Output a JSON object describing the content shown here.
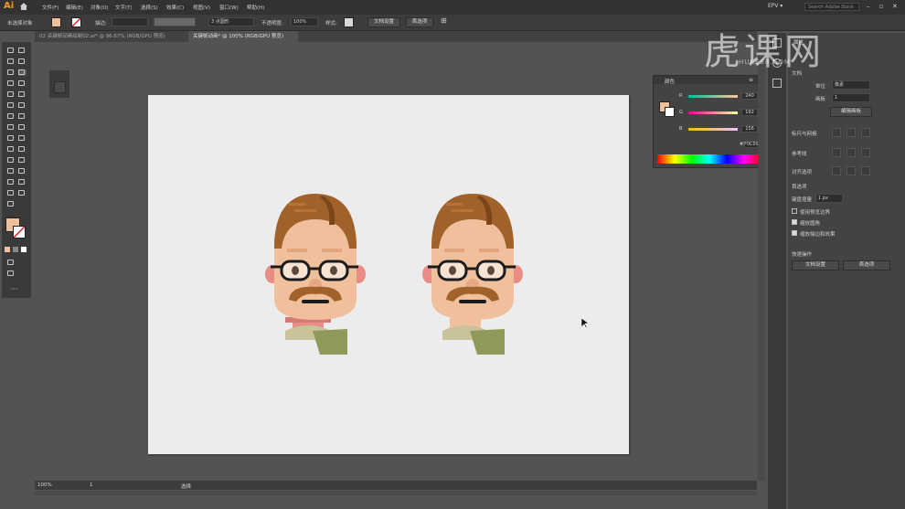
{
  "app": {
    "logo": "Ai",
    "workspace": "EPV ▾",
    "search_placeholder": "Search Adobe Stock"
  },
  "menu": [
    "文件(F)",
    "编辑(E)",
    "对象(O)",
    "文字(T)",
    "选择(S)",
    "效果(C)",
    "视图(V)",
    "窗口(W)",
    "帮助(H)"
  ],
  "control": {
    "selection_label": "未选择对象",
    "stroke_label": "描边:",
    "brush_label": "3 点圆形",
    "opacity_label": "不透明度:",
    "opacity_value": "100%",
    "style_label": "样式:",
    "doc_setup": "文档设置",
    "prefs": "首选项"
  },
  "tabs": [
    {
      "label": "02 关键帧动画绘制02.ai* @ 96.67% (RGB/GPU 预览)",
      "active": false
    },
    {
      "label": "关键帧动画* @ 100% (RGB/GPU 预览)",
      "active": true
    }
  ],
  "color_panel": {
    "title": "颜色",
    "channels": [
      {
        "label": "R",
        "value": "240"
      },
      {
        "label": "G",
        "value": "192"
      },
      {
        "label": "B",
        "value": "156"
      }
    ],
    "hex": "F0C09C",
    "fill_color": "#F0C09C"
  },
  "properties": {
    "tab": "属性",
    "section_doc": "文档",
    "unit_label": "单位",
    "unit_value": "像素",
    "artboard_label": "画板",
    "artboard_value": "1",
    "edit_artboards": "编辑画板",
    "ruler_grid_label": "标尺与网格",
    "guides_label": "参考线",
    "snap_label": "对齐选项",
    "prefs_section": "首选项",
    "key_increment_label": "键盘增量",
    "key_increment_value": "1 px",
    "preview_bounds": "使用预览边界",
    "scale_corners": "缩放圆角",
    "scale_strokes": "缩放描边和效果",
    "quick_actions": "快速操作",
    "doc_setup_btn": "文档设置",
    "prefs_btn": "首选项"
  },
  "status": {
    "zoom": "100%",
    "artboard_num": "1",
    "tool": "选择"
  },
  "watermark": {
    "text": "虎课网",
    "url": "HUKE88.COM"
  },
  "colors": {
    "hair": "#A0622A",
    "hair_dark": "#7C4519",
    "skin": "#F0C09C",
    "skin_shadow": "#E6A784",
    "cheek": "#E88C84",
    "neck": "#E98E86",
    "mustache": "#A0622A",
    "shirt": "#C9C39A",
    "collar": "#8F9A5A"
  }
}
